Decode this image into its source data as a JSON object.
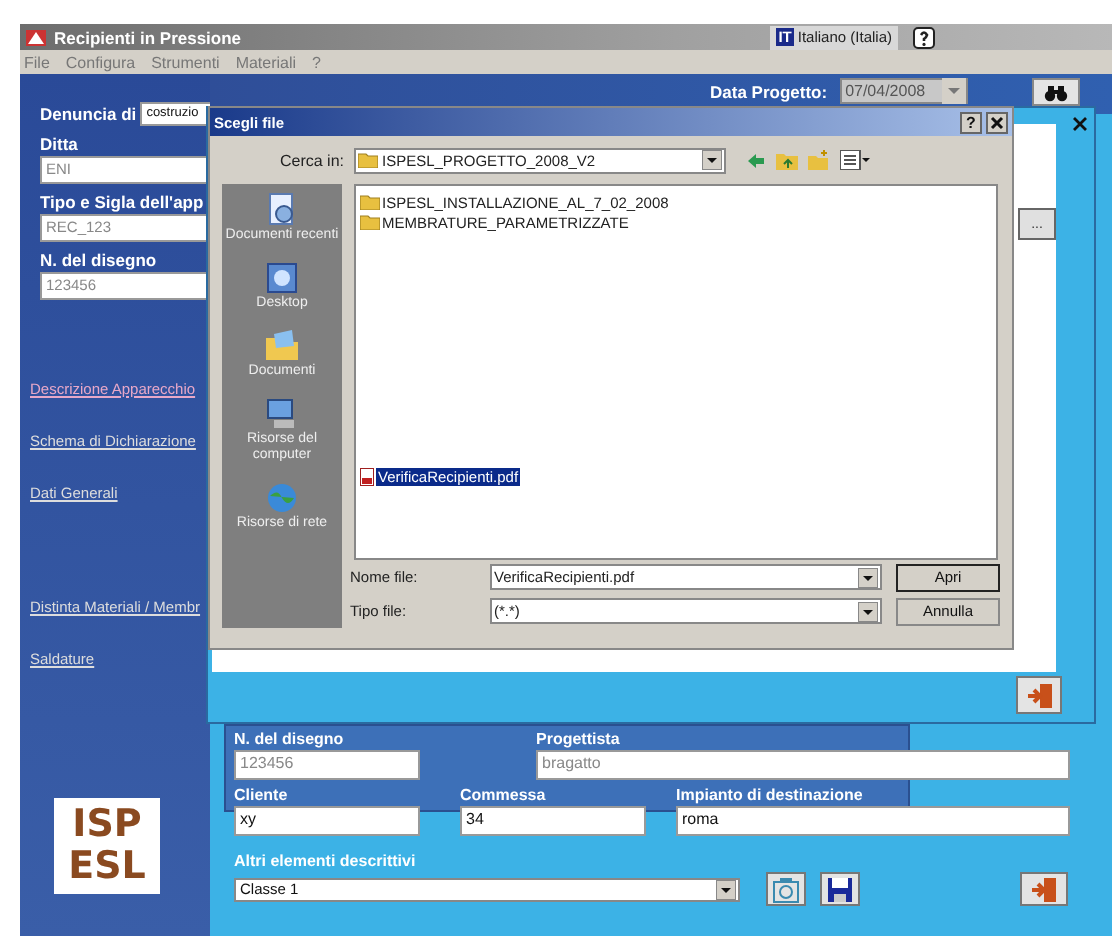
{
  "window": {
    "title": "Recipienti in Pressione",
    "language_code": "IT",
    "language": "Italiano (Italia)"
  },
  "menu": [
    "File",
    "Configura",
    "Strumenti",
    "Materiali",
    "?"
  ],
  "header": {
    "date_label": "Data Progetto:",
    "date_value": "07/04/2008"
  },
  "left_form": {
    "denuncia_label": "Denuncia di",
    "denuncia_value": "costruzio",
    "fields": [
      {
        "label": "Ditta",
        "value": "ENI",
        "disabled": true
      },
      {
        "label": "Tipo e Sigla dell'app",
        "value": "REC_123",
        "disabled": true
      },
      {
        "label": "N. del disegno",
        "value": "123456",
        "disabled": true
      }
    ]
  },
  "nav_groups": [
    [
      {
        "label": "Descrizione Apparecchio",
        "selected": true
      },
      {
        "label": "Schema di Dichiarazione",
        "selected": false
      },
      {
        "label": "Dati Generali",
        "selected": false
      }
    ],
    [
      {
        "label": "Distinta Materiali / Membr",
        "selected": false
      },
      {
        "label": "Saldature",
        "selected": false
      }
    ]
  ],
  "logo": [
    "ISP",
    "ESL"
  ],
  "back_window": {
    "browse_button": "..."
  },
  "dialog": {
    "title": "Scegli file",
    "help": "?",
    "look_in_label": "Cerca in:",
    "look_in_value": "ISPESL_PROGETTO_2008_V2",
    "places": [
      {
        "label": "Documenti recenti",
        "kind": "recent"
      },
      {
        "label": "Desktop",
        "kind": "desktop"
      },
      {
        "label": "Documenti",
        "kind": "documents"
      },
      {
        "label": "Risorse del computer",
        "kind": "computer"
      },
      {
        "label": "Risorse di rete",
        "kind": "network"
      }
    ],
    "folders": [
      {
        "name": "ISPESL_INSTALLAZIONE_AL_7_02_2008",
        "selected": false
      },
      {
        "name": "MEMBRATURE_PARAMETRIZZATE",
        "selected": false
      }
    ],
    "files": [
      {
        "name": "VerificaRecipienti.pdf",
        "selected": true
      }
    ],
    "filename_label": "Nome file:",
    "filename_value": "VerificaRecipienti.pdf",
    "filetype_label": "Tipo file:",
    "filetype_value": "(*.*)",
    "open_button": "Apri",
    "cancel_button": "Annulla"
  },
  "details": {
    "row_1": [
      {
        "label": "N. del disegno",
        "value": "123456",
        "disabled": true
      },
      {
        "label": "Progettista",
        "value": "bragatto",
        "disabled": true
      }
    ],
    "row_2": [
      {
        "label": "Cliente",
        "value": "xy",
        "disabled": false
      },
      {
        "label": "Commessa",
        "value": "34",
        "disabled": false
      },
      {
        "label": "Impianto di destinazione",
        "value": "roma",
        "disabled": false
      }
    ],
    "other_label": "Altri elementi descrittivi",
    "other_value": "Classe 1"
  }
}
